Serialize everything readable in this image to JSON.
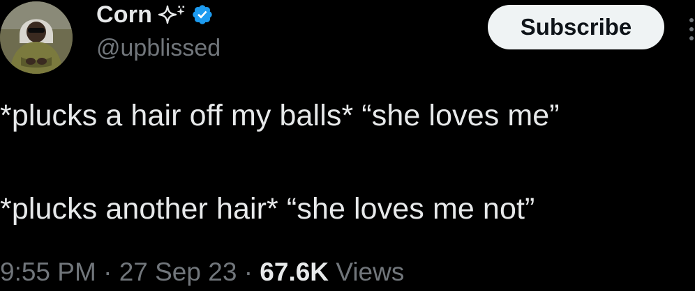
{
  "author": {
    "display_name": "Corn",
    "name_emoji": "sparkles",
    "verified": true,
    "verified_color": "#1d9bf0",
    "handle": "@upblissed"
  },
  "subscribe_button": {
    "label": "Subscribe"
  },
  "tweet": {
    "line1": "*plucks a hair off my balls* “she loves me”",
    "line2": "*plucks another hair* “she loves me not”"
  },
  "meta": {
    "time": "9:55 PM",
    "date": "27 Sep 23",
    "separator": "·",
    "views_count": "67.6K",
    "views_label": "Views"
  },
  "colors": {
    "background": "#000000",
    "text": "#e7e9ea",
    "secondary": "#71767b",
    "button_bg": "#eff3f4"
  },
  "icons": [
    "avatar",
    "sparkle-icon",
    "verified-badge-icon",
    "more-icon"
  ]
}
